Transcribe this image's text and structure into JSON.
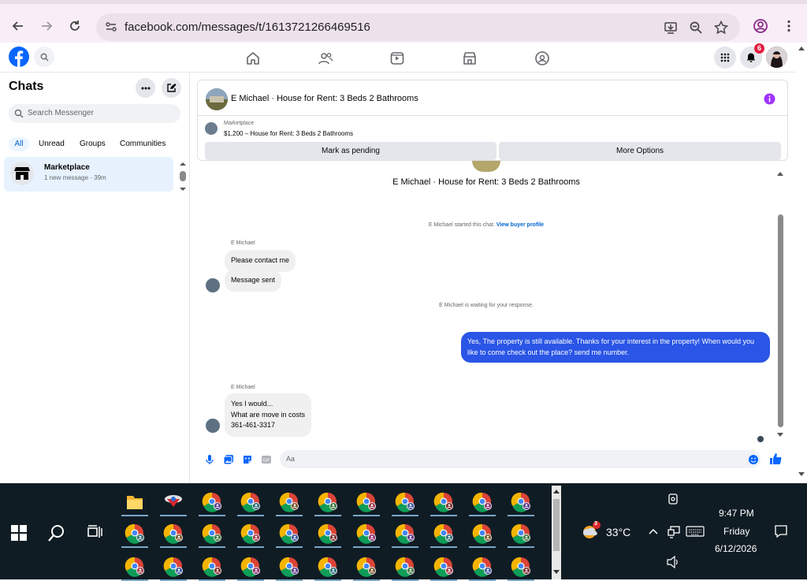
{
  "browser": {
    "url": "facebook.com/messages/t/1613721266469516"
  },
  "fb_topbar": {
    "notification_count": "6"
  },
  "sidebar": {
    "title": "Chats",
    "search_placeholder": "Search Messenger",
    "filters": [
      "All",
      "Unread",
      "Groups",
      "Communities"
    ],
    "active_filter": "All",
    "chat_item": {
      "name": "Marketplace",
      "subtitle": "1 new message · 39m"
    }
  },
  "conversation": {
    "header_title": "E Michael · House for Rent: 3 Beds 2 Bathrooms",
    "marketplace": {
      "label": "Marketplace",
      "price_line": "$1,200 – House for Rent: 3 Beds 2 Bathrooms",
      "button_pending": "Mark as pending",
      "button_more": "More Options"
    },
    "big_title": "E Michael · House for Rent: 3 Beds 2 Bathrooms",
    "started_text": "E Michael started this chat.",
    "buyer_link": "View buyer profile",
    "sender_name_1": "E Michael",
    "msg_1": "Please contact me",
    "msg_2": "Message sent",
    "waiting_text": "E Michael is waiting for your response.",
    "outgoing": "Yes, The property is still available. Thanks for your interest in the property! When would you like to come check out the place? send me number.",
    "sender_name_2": "E Michael",
    "msg_3": "Yes I would...\nWhat are move in costs\n361-461-3317",
    "composer_placeholder": "Aa"
  },
  "taskbar": {
    "weather_temp": "33°C",
    "weather_badge": "3",
    "time": "9:47 PM",
    "day": "Friday",
    "date": "6/12/2026"
  },
  "colors": {
    "fb_blue": "#0866ff",
    "outgoing_bubble": "#2a55e6",
    "taskbar_bg": "#101c24",
    "browser_bg": "#f9eef7"
  }
}
